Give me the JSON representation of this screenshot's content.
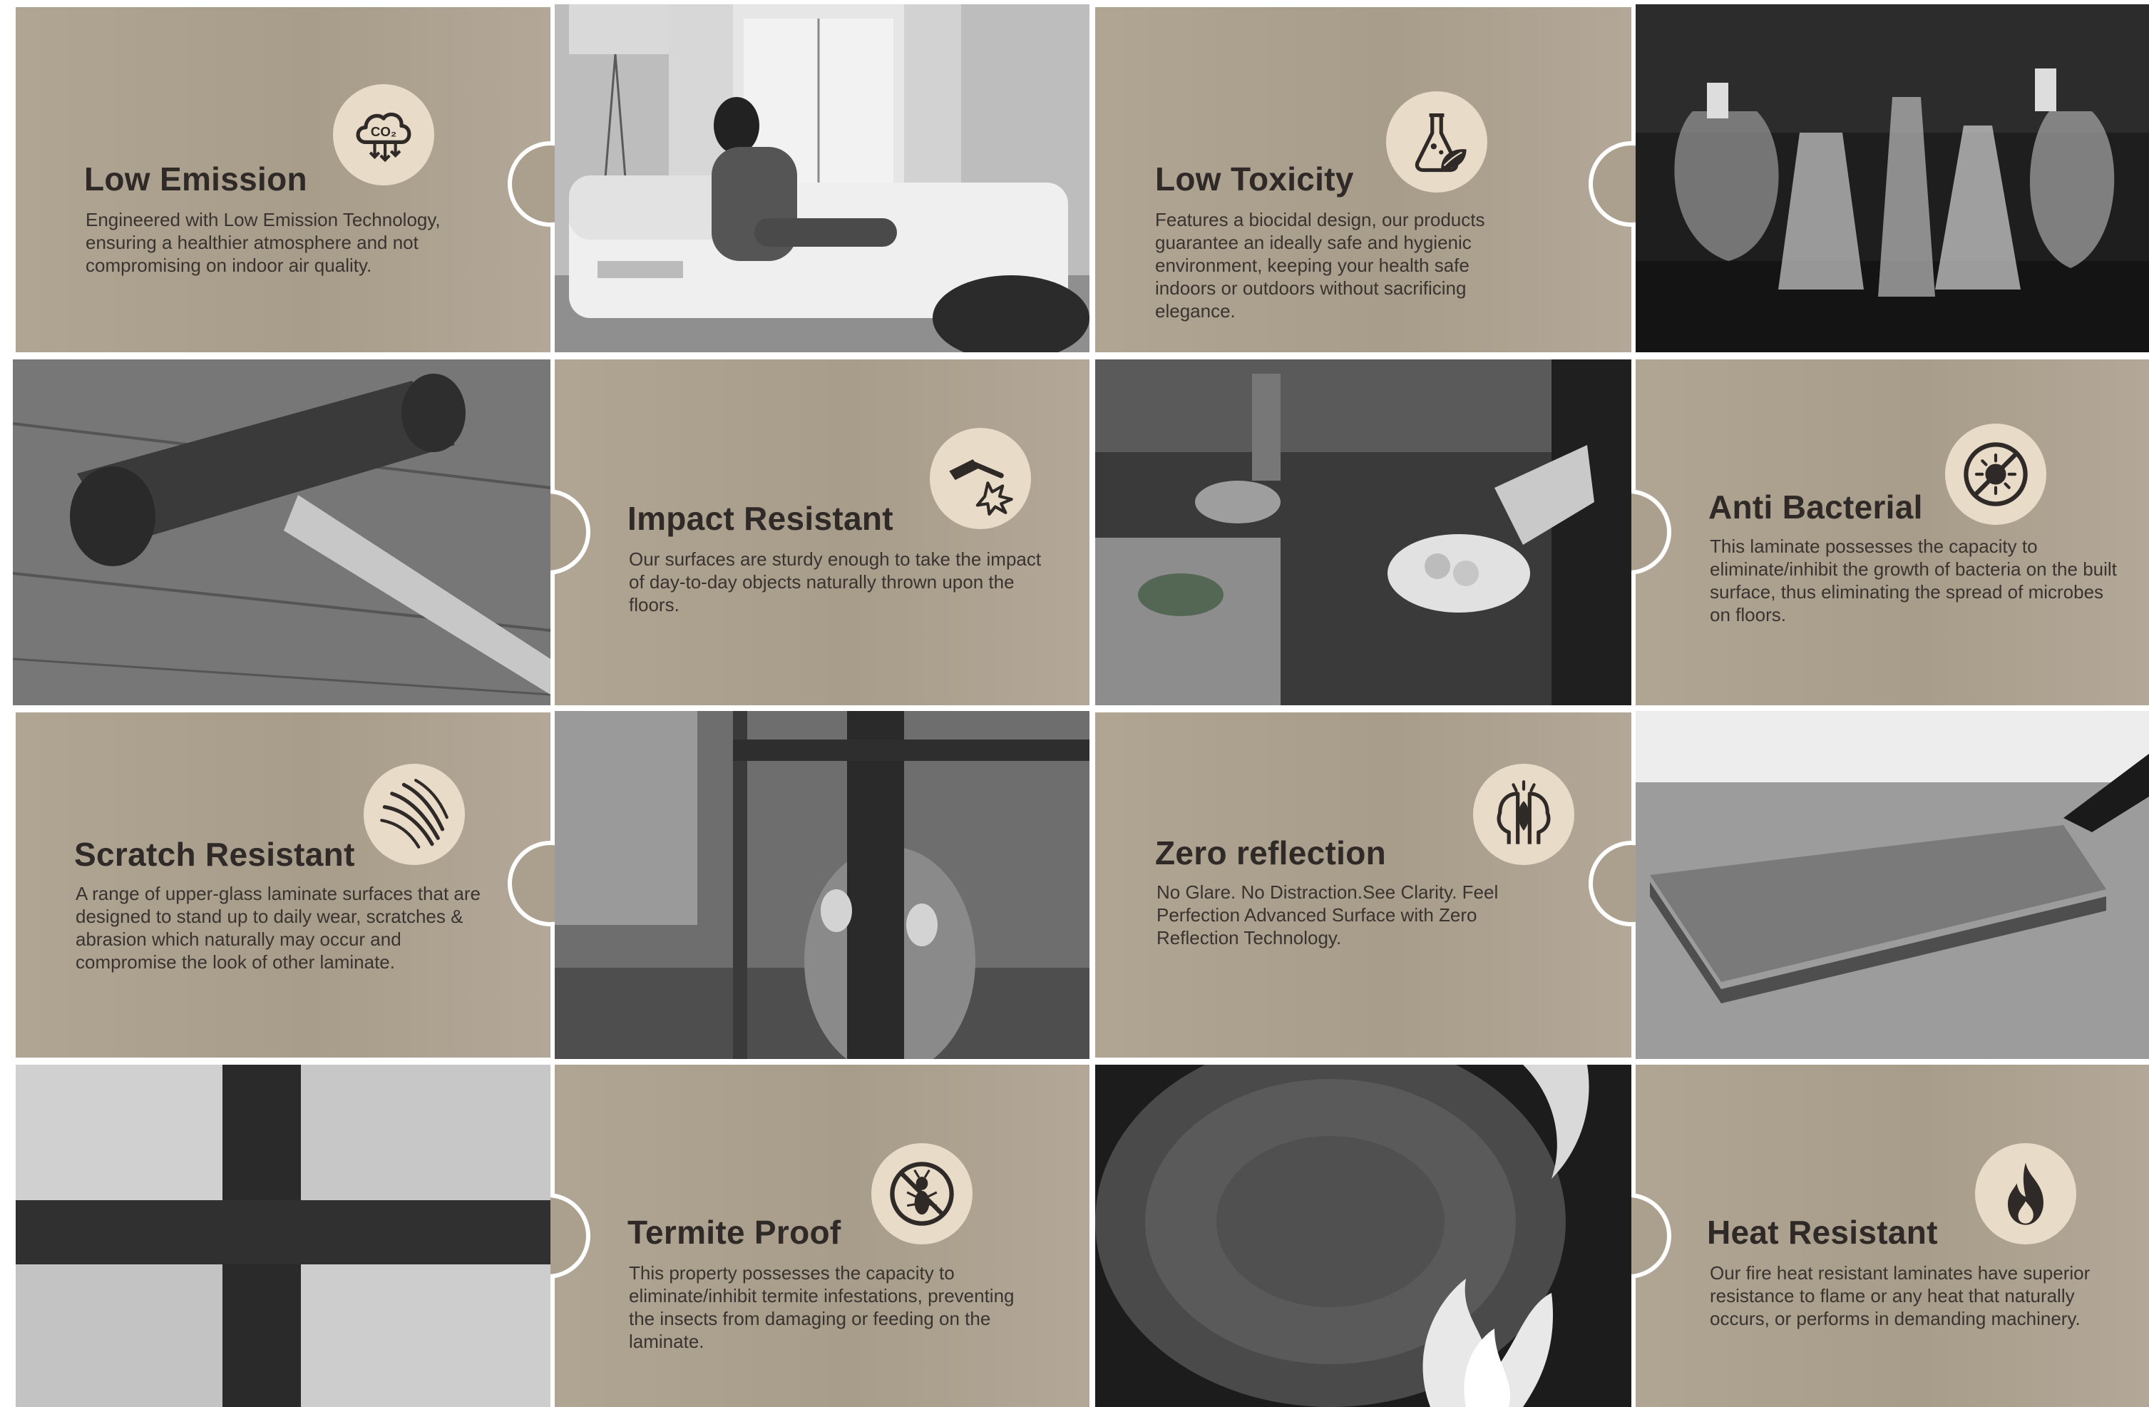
{
  "features": {
    "low_emission": {
      "title": "Low Emission",
      "icon": "co2-cloud-icon",
      "icon_text": "CO₂",
      "desc": "Engineered with Low Emission Technology, ensuring a healthier atmosphere and not compromising on indoor air quality."
    },
    "low_toxicity": {
      "title": "Low Toxicity",
      "icon": "flask-leaf-icon",
      "desc": "Features a biocidal design, our products guarantee an ideally safe and hygienic environment, keeping your health safe indoors or outdoors without sacrificing elegance."
    },
    "impact_resistant": {
      "title": "Impact Resistant",
      "icon": "hammer-impact-icon",
      "desc": "Our surfaces are sturdy enough to take the impact of day-to-day objects naturally thrown upon the floors."
    },
    "anti_bacterial": {
      "title": "Anti Bacterial",
      "icon": "no-bacteria-icon",
      "desc": "This laminate possesses the capacity to eliminate/inhibit the growth of bacteria on the built surface, thus eliminating the spread of microbes on floors."
    },
    "scratch_resistant": {
      "title": "Scratch Resistant",
      "icon": "claw-scratch-icon",
      "desc": "A range of upper-glass laminate surfaces that are designed to stand up to daily wear, scratches & abrasion which naturally may occur and compromise the look of other laminate."
    },
    "zero_reflection": {
      "title": "Zero reflection",
      "icon": "mind-clarity-icon",
      "desc": "No Glare. No Distraction.See Clarity. Feel Perfection Advanced Surface with Zero Reflection Technology."
    },
    "termite_proof": {
      "title": "Termite Proof",
      "icon": "no-termite-icon",
      "desc": "This property possesses the capacity to eliminate/inhibit termite infestations, preventing the insects from damaging or feeding on the laminate."
    },
    "heat_resistant": {
      "title": "Heat Resistant",
      "icon": "flame-icon",
      "desc": "Our fire heat resistant laminates have superior resistance to flame or any heat that naturally occurs, or performs in demanding machinery."
    }
  },
  "photos": [
    "woman-on-sofa-photo",
    "chemistry-flasks-photo",
    "hammer-on-floor-photo",
    "chef-plating-photo",
    "cat-scratching-table-leg-photo",
    "laminate-planks-photo",
    "termite-damaged-window-photo",
    "burning-log-photo"
  ],
  "colors": {
    "panel": "#ab9f8d",
    "icon_badge": "#e8dcc9",
    "title_text": "#2f2a27",
    "body_text": "#3a3430"
  }
}
